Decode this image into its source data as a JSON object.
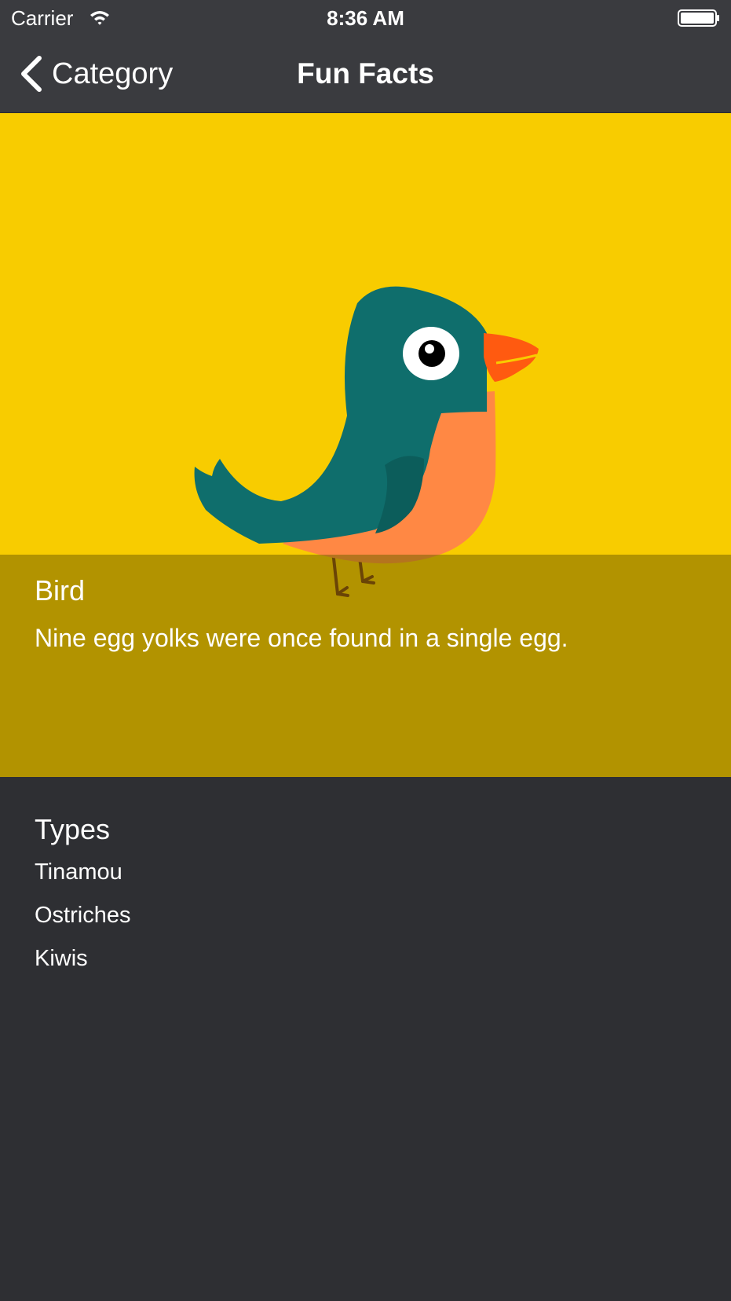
{
  "status_bar": {
    "carrier": "Carrier",
    "time": "8:36 AM",
    "wifi_icon": "wifi-icon",
    "battery_icon": "battery-icon"
  },
  "nav_bar": {
    "back_label": "Category",
    "back_icon": "chevron-left-icon",
    "title": "Fun Facts"
  },
  "hero": {
    "background_color": "#f8cc00",
    "illustration": "bird-illustration",
    "overlay_color": "#aa8c00"
  },
  "fact": {
    "category": "Bird",
    "text": "Nine egg yolks were once found in a single egg."
  },
  "types": {
    "title": "Types",
    "items": [
      "Tinamou",
      "Ostriches",
      "Kiwis"
    ]
  },
  "colors": {
    "background": "#2e2f33",
    "bar": "#3a3b3f",
    "bird_body": "#0f6e6c",
    "bird_belly": "#ff8844",
    "bird_beak": "#ff5a10"
  }
}
